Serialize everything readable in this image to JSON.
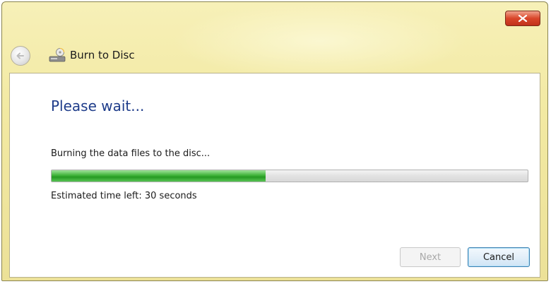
{
  "window": {
    "title": "Burn to Disc"
  },
  "content": {
    "heading": "Please wait...",
    "status": "Burning the data files to the disc...",
    "progress_percent": 45,
    "time_left": "Estimated time left: 30 seconds"
  },
  "buttons": {
    "next_label": "Next",
    "cancel_label": "Cancel"
  },
  "icons": {
    "close": "close-icon",
    "back": "back-arrow-icon",
    "burn": "burn-disc-icon"
  },
  "colors": {
    "heading": "#1e3c8a",
    "progress": "#3fb33a",
    "close": "#d9462a"
  }
}
